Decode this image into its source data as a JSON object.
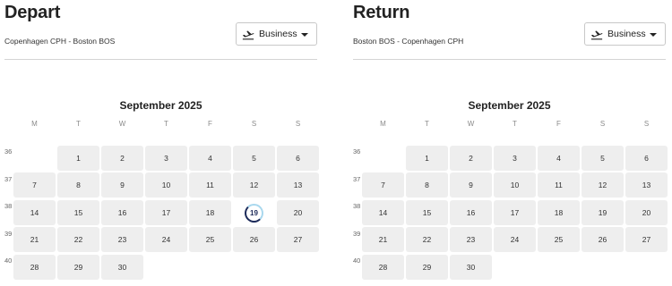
{
  "depart": {
    "title": "Depart",
    "route": "Copenhagen CPH - Boston BOS",
    "cabin": "Business",
    "month": "September 2025",
    "selected_day": "19"
  },
  "return": {
    "title": "Return",
    "route": "Boston BOS - Copenhagen CPH",
    "cabin": "Business",
    "month": "September 2025"
  },
  "weekdays": [
    "M",
    "T",
    "W",
    "T",
    "F",
    "S",
    "S"
  ],
  "weeks": [
    {
      "num": "36",
      "days": [
        "",
        "1",
        "2",
        "3",
        "4",
        "5",
        "6"
      ]
    },
    {
      "num": "37",
      "days": [
        "7",
        "8",
        "9",
        "10",
        "11",
        "12",
        "13"
      ]
    },
    {
      "num": "38",
      "days": [
        "14",
        "15",
        "16",
        "17",
        "18",
        "19",
        "20"
      ]
    },
    {
      "num": "39",
      "days": [
        "21",
        "22",
        "23",
        "24",
        "25",
        "26",
        "27"
      ]
    },
    {
      "num": "40",
      "days": [
        "28",
        "29",
        "30",
        "",
        "",
        "",
        ""
      ]
    }
  ],
  "icons": {
    "cabin": "plane-takeoff-icon",
    "dropdown": "chevron-down-icon"
  }
}
